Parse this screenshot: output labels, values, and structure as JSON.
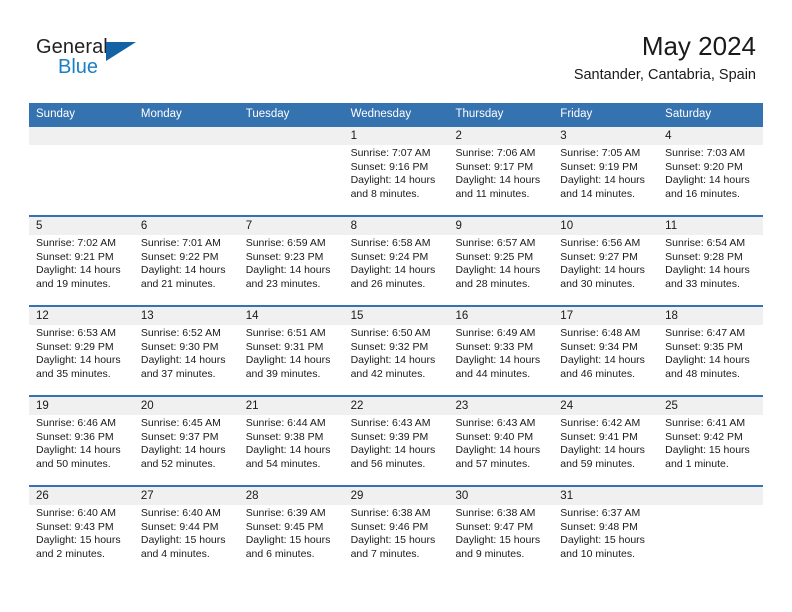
{
  "brand": {
    "name_part1": "General",
    "name_part2": "Blue",
    "triangle_icon": "triangle-icon",
    "color_dark": "#231f20",
    "color_blue": "#1c7fc4"
  },
  "header": {
    "title": "May 2024",
    "subtitle": "Santander, Cantabria, Spain",
    "accent_color": "#3572b0"
  },
  "calendar": {
    "weekday_headers": [
      "Sunday",
      "Monday",
      "Tuesday",
      "Wednesday",
      "Thursday",
      "Friday",
      "Saturday"
    ],
    "header_bg": "#3572b0",
    "daynum_bg": "#f0f0f0",
    "weeks": [
      [
        {
          "day": "",
          "sunrise": "",
          "sunset": "",
          "daylight_line1": "",
          "daylight_line2": ""
        },
        {
          "day": "",
          "sunrise": "",
          "sunset": "",
          "daylight_line1": "",
          "daylight_line2": ""
        },
        {
          "day": "",
          "sunrise": "",
          "sunset": "",
          "daylight_line1": "",
          "daylight_line2": ""
        },
        {
          "day": "1",
          "sunrise": "Sunrise: 7:07 AM",
          "sunset": "Sunset: 9:16 PM",
          "daylight_line1": "Daylight: 14 hours",
          "daylight_line2": "and 8 minutes."
        },
        {
          "day": "2",
          "sunrise": "Sunrise: 7:06 AM",
          "sunset": "Sunset: 9:17 PM",
          "daylight_line1": "Daylight: 14 hours",
          "daylight_line2": "and 11 minutes."
        },
        {
          "day": "3",
          "sunrise": "Sunrise: 7:05 AM",
          "sunset": "Sunset: 9:19 PM",
          "daylight_line1": "Daylight: 14 hours",
          "daylight_line2": "and 14 minutes."
        },
        {
          "day": "4",
          "sunrise": "Sunrise: 7:03 AM",
          "sunset": "Sunset: 9:20 PM",
          "daylight_line1": "Daylight: 14 hours",
          "daylight_line2": "and 16 minutes."
        }
      ],
      [
        {
          "day": "5",
          "sunrise": "Sunrise: 7:02 AM",
          "sunset": "Sunset: 9:21 PM",
          "daylight_line1": "Daylight: 14 hours",
          "daylight_line2": "and 19 minutes."
        },
        {
          "day": "6",
          "sunrise": "Sunrise: 7:01 AM",
          "sunset": "Sunset: 9:22 PM",
          "daylight_line1": "Daylight: 14 hours",
          "daylight_line2": "and 21 minutes."
        },
        {
          "day": "7",
          "sunrise": "Sunrise: 6:59 AM",
          "sunset": "Sunset: 9:23 PM",
          "daylight_line1": "Daylight: 14 hours",
          "daylight_line2": "and 23 minutes."
        },
        {
          "day": "8",
          "sunrise": "Sunrise: 6:58 AM",
          "sunset": "Sunset: 9:24 PM",
          "daylight_line1": "Daylight: 14 hours",
          "daylight_line2": "and 26 minutes."
        },
        {
          "day": "9",
          "sunrise": "Sunrise: 6:57 AM",
          "sunset": "Sunset: 9:25 PM",
          "daylight_line1": "Daylight: 14 hours",
          "daylight_line2": "and 28 minutes."
        },
        {
          "day": "10",
          "sunrise": "Sunrise: 6:56 AM",
          "sunset": "Sunset: 9:27 PM",
          "daylight_line1": "Daylight: 14 hours",
          "daylight_line2": "and 30 minutes."
        },
        {
          "day": "11",
          "sunrise": "Sunrise: 6:54 AM",
          "sunset": "Sunset: 9:28 PM",
          "daylight_line1": "Daylight: 14 hours",
          "daylight_line2": "and 33 minutes."
        }
      ],
      [
        {
          "day": "12",
          "sunrise": "Sunrise: 6:53 AM",
          "sunset": "Sunset: 9:29 PM",
          "daylight_line1": "Daylight: 14 hours",
          "daylight_line2": "and 35 minutes."
        },
        {
          "day": "13",
          "sunrise": "Sunrise: 6:52 AM",
          "sunset": "Sunset: 9:30 PM",
          "daylight_line1": "Daylight: 14 hours",
          "daylight_line2": "and 37 minutes."
        },
        {
          "day": "14",
          "sunrise": "Sunrise: 6:51 AM",
          "sunset": "Sunset: 9:31 PM",
          "daylight_line1": "Daylight: 14 hours",
          "daylight_line2": "and 39 minutes."
        },
        {
          "day": "15",
          "sunrise": "Sunrise: 6:50 AM",
          "sunset": "Sunset: 9:32 PM",
          "daylight_line1": "Daylight: 14 hours",
          "daylight_line2": "and 42 minutes."
        },
        {
          "day": "16",
          "sunrise": "Sunrise: 6:49 AM",
          "sunset": "Sunset: 9:33 PM",
          "daylight_line1": "Daylight: 14 hours",
          "daylight_line2": "and 44 minutes."
        },
        {
          "day": "17",
          "sunrise": "Sunrise: 6:48 AM",
          "sunset": "Sunset: 9:34 PM",
          "daylight_line1": "Daylight: 14 hours",
          "daylight_line2": "and 46 minutes."
        },
        {
          "day": "18",
          "sunrise": "Sunrise: 6:47 AM",
          "sunset": "Sunset: 9:35 PM",
          "daylight_line1": "Daylight: 14 hours",
          "daylight_line2": "and 48 minutes."
        }
      ],
      [
        {
          "day": "19",
          "sunrise": "Sunrise: 6:46 AM",
          "sunset": "Sunset: 9:36 PM",
          "daylight_line1": "Daylight: 14 hours",
          "daylight_line2": "and 50 minutes."
        },
        {
          "day": "20",
          "sunrise": "Sunrise: 6:45 AM",
          "sunset": "Sunset: 9:37 PM",
          "daylight_line1": "Daylight: 14 hours",
          "daylight_line2": "and 52 minutes."
        },
        {
          "day": "21",
          "sunrise": "Sunrise: 6:44 AM",
          "sunset": "Sunset: 9:38 PM",
          "daylight_line1": "Daylight: 14 hours",
          "daylight_line2": "and 54 minutes."
        },
        {
          "day": "22",
          "sunrise": "Sunrise: 6:43 AM",
          "sunset": "Sunset: 9:39 PM",
          "daylight_line1": "Daylight: 14 hours",
          "daylight_line2": "and 56 minutes."
        },
        {
          "day": "23",
          "sunrise": "Sunrise: 6:43 AM",
          "sunset": "Sunset: 9:40 PM",
          "daylight_line1": "Daylight: 14 hours",
          "daylight_line2": "and 57 minutes."
        },
        {
          "day": "24",
          "sunrise": "Sunrise: 6:42 AM",
          "sunset": "Sunset: 9:41 PM",
          "daylight_line1": "Daylight: 14 hours",
          "daylight_line2": "and 59 minutes."
        },
        {
          "day": "25",
          "sunrise": "Sunrise: 6:41 AM",
          "sunset": "Sunset: 9:42 PM",
          "daylight_line1": "Daylight: 15 hours",
          "daylight_line2": "and 1 minute."
        }
      ],
      [
        {
          "day": "26",
          "sunrise": "Sunrise: 6:40 AM",
          "sunset": "Sunset: 9:43 PM",
          "daylight_line1": "Daylight: 15 hours",
          "daylight_line2": "and 2 minutes."
        },
        {
          "day": "27",
          "sunrise": "Sunrise: 6:40 AM",
          "sunset": "Sunset: 9:44 PM",
          "daylight_line1": "Daylight: 15 hours",
          "daylight_line2": "and 4 minutes."
        },
        {
          "day": "28",
          "sunrise": "Sunrise: 6:39 AM",
          "sunset": "Sunset: 9:45 PM",
          "daylight_line1": "Daylight: 15 hours",
          "daylight_line2": "and 6 minutes."
        },
        {
          "day": "29",
          "sunrise": "Sunrise: 6:38 AM",
          "sunset": "Sunset: 9:46 PM",
          "daylight_line1": "Daylight: 15 hours",
          "daylight_line2": "and 7 minutes."
        },
        {
          "day": "30",
          "sunrise": "Sunrise: 6:38 AM",
          "sunset": "Sunset: 9:47 PM",
          "daylight_line1": "Daylight: 15 hours",
          "daylight_line2": "and 9 minutes."
        },
        {
          "day": "31",
          "sunrise": "Sunrise: 6:37 AM",
          "sunset": "Sunset: 9:48 PM",
          "daylight_line1": "Daylight: 15 hours",
          "daylight_line2": "and 10 minutes."
        },
        {
          "day": "",
          "sunrise": "",
          "sunset": "",
          "daylight_line1": "",
          "daylight_line2": ""
        }
      ]
    ]
  }
}
